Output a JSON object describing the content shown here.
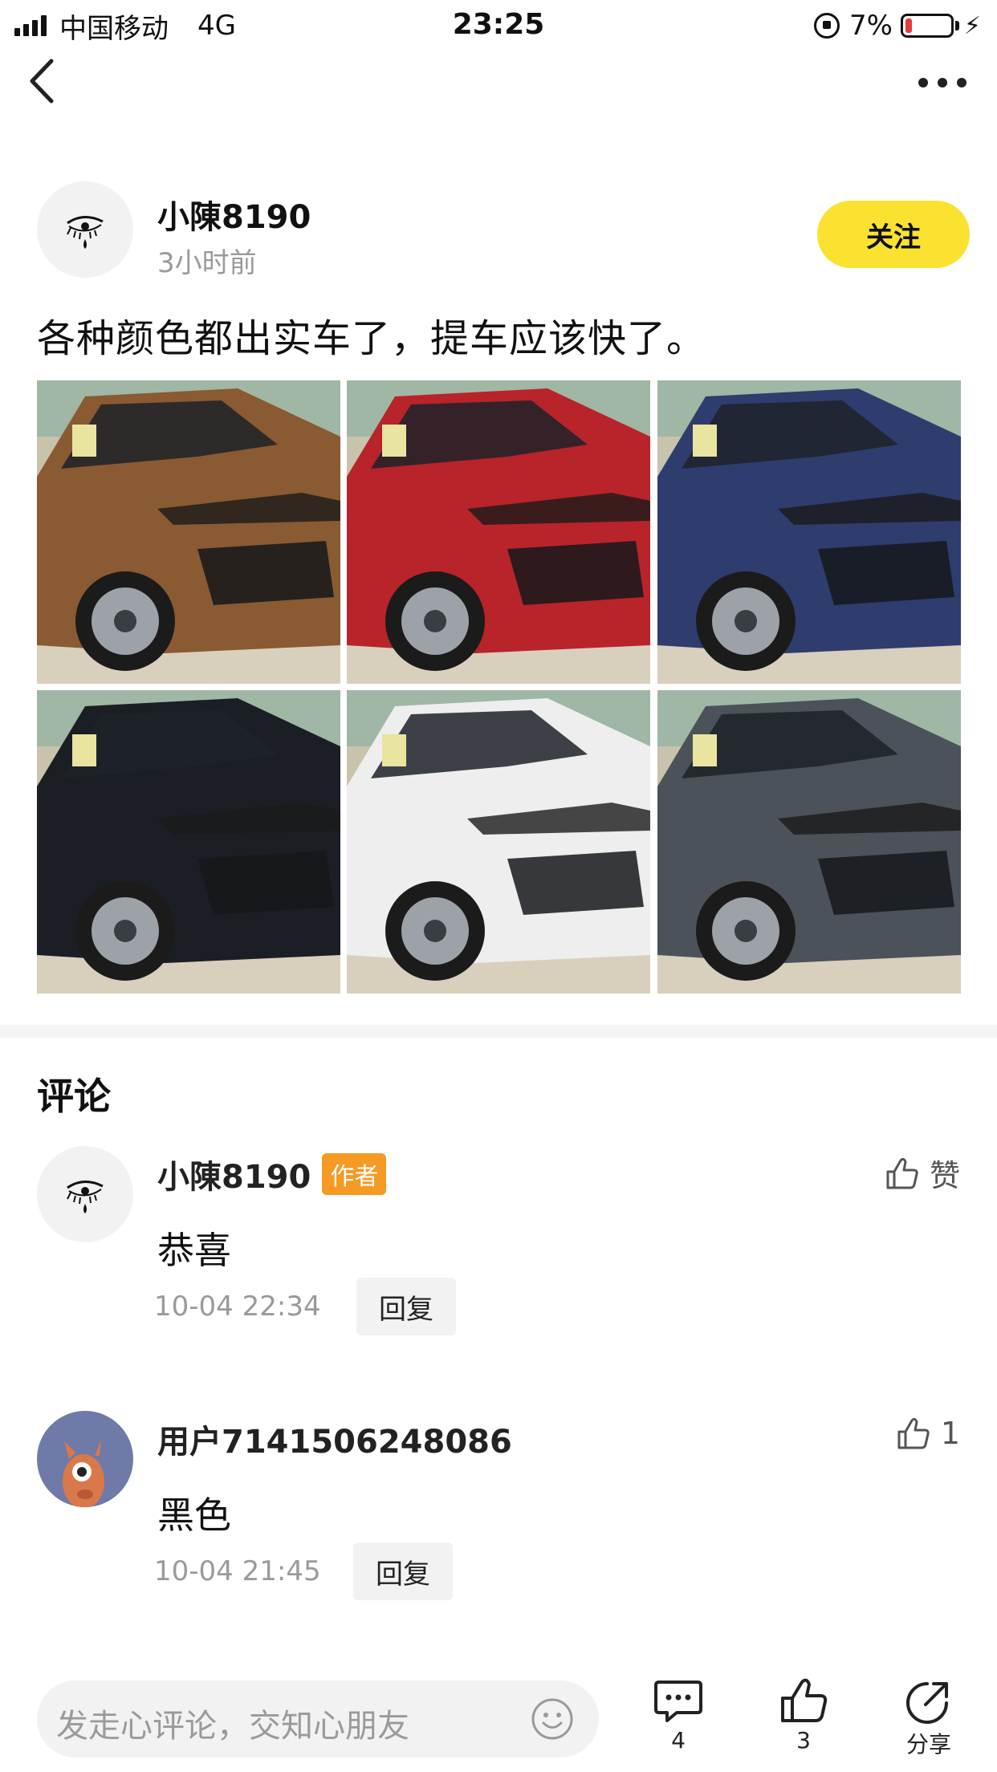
{
  "status_bar": {
    "carrier": "中国移动",
    "network": "4G",
    "time": "23:25",
    "battery_text": "7%",
    "battery_level": 0.07,
    "battery_color": "#e53b3b"
  },
  "nav": {
    "back_icon": "chevron-left-icon",
    "more_icon": "more-dots-icon"
  },
  "post": {
    "author": "小陳8190",
    "time": "3小时前",
    "follow_label": "关注",
    "text": "各种颜色都出实车了，提车应该快了。",
    "images": [
      {
        "label": "car-photo-brown",
        "color": "#8a5a32"
      },
      {
        "label": "car-photo-red",
        "color": "#b8242a"
      },
      {
        "label": "car-photo-blue",
        "color": "#2f3c6e"
      },
      {
        "label": "car-photo-black",
        "color": "#1b1e24"
      },
      {
        "label": "car-photo-white",
        "color": "#eeeeee"
      },
      {
        "label": "car-photo-gray",
        "color": "#4b5259"
      }
    ]
  },
  "comments_title": "评论",
  "comments": [
    {
      "name": "小陳8190",
      "tag": "作者",
      "text": "恭喜",
      "date": "10-04 22:34",
      "reply_label": "回复",
      "like_label": "赞"
    },
    {
      "name": "用户7141506248086",
      "text": "黑色",
      "date": "10-04 21:45",
      "reply_label": "回复",
      "like_label": "1"
    }
  ],
  "bottom_bar": {
    "input_placeholder": "发走心评论，交知心朋友",
    "comment_count": "4",
    "like_count": "3",
    "share_label": "分享"
  },
  "colors": {
    "accent_yellow": "#fbe231",
    "author_tag": "#f59a23"
  }
}
